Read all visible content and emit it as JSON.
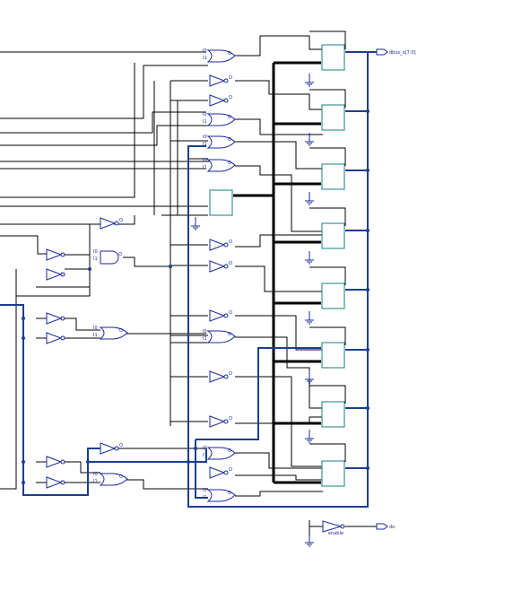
{
  "schematic": {
    "output_ports": [
      {
        "label": "dbus_o[7:0]"
      },
      {
        "label": "do"
      }
    ],
    "gate_pins": {
      "in0": "I0",
      "in1": "I1",
      "out": "O"
    },
    "buffer_label": "enable",
    "colors": {
      "wire": "#000000",
      "bus": "#1a3f8f",
      "gate": "#1a2a9a",
      "flipflop": "#1b7d86"
    }
  }
}
